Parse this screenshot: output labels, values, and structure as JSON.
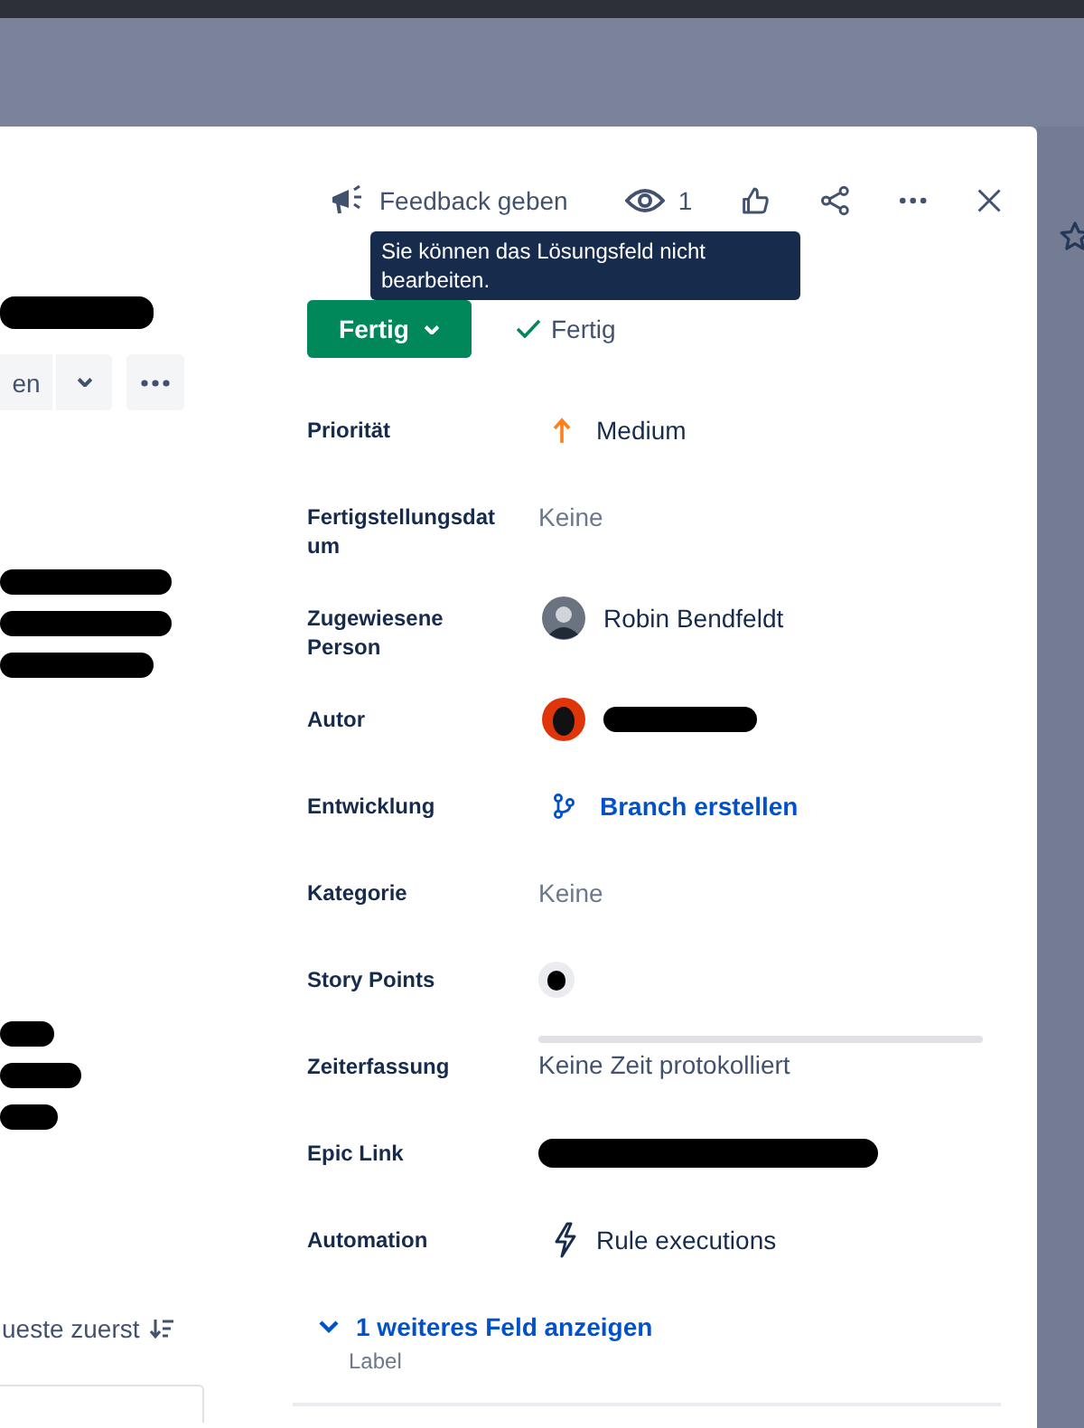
{
  "header": {
    "feedback": "Feedback geben",
    "watchers": "1"
  },
  "tooltip": "Sie können das Lösungsfeld nicht bearbeiten.",
  "status": {
    "button": "Fertig",
    "resolution": "Fertig"
  },
  "left": {
    "action_button": "en",
    "sort": "ueste zuerst"
  },
  "fields": [
    {
      "kind": "priority",
      "label": "Priorität",
      "value": "Medium"
    },
    {
      "kind": "muted",
      "label": "Fertigstellungsdatum",
      "value": "Keine"
    },
    {
      "kind": "user",
      "label": "Zugewiesene Person",
      "value": "Robin Bendfeldt"
    },
    {
      "kind": "redacted-user",
      "label": "Autor"
    },
    {
      "kind": "branch",
      "label": "Entwicklung",
      "value": "Branch erstellen"
    },
    {
      "kind": "muted",
      "label": "Kategorie",
      "value": "Keine"
    },
    {
      "kind": "points",
      "label": "Story Points"
    },
    {
      "kind": "time",
      "label": "Zeiterfassung",
      "value": "Keine Zeit protokolliert",
      "level": 0
    },
    {
      "kind": "redacted",
      "label": "Epic Link"
    },
    {
      "kind": "automation",
      "label": "Automation",
      "value": "Rule executions"
    }
  ],
  "more": {
    "link": "1 weiteres Feld anzeigen",
    "hint": "Label"
  }
}
